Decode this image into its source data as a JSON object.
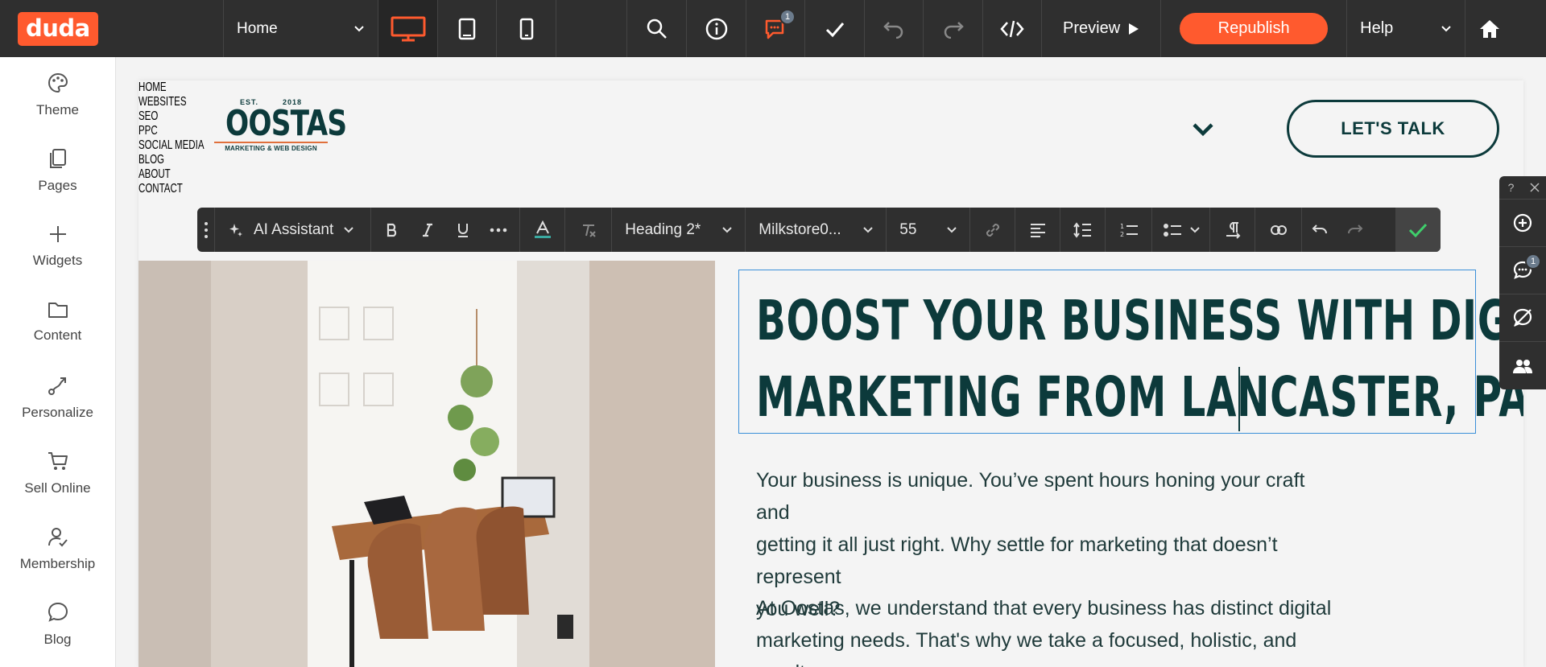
{
  "app": {
    "logo": "duda",
    "page_select": "Home",
    "preview_label": "Preview",
    "republish_label": "Republish",
    "help_label": "Help",
    "comments_badge": "1",
    "brand_color": "#ff5a2e"
  },
  "sidebar": {
    "items": [
      {
        "label": "Theme",
        "icon": "palette-icon"
      },
      {
        "label": "Pages",
        "icon": "pages-icon"
      },
      {
        "label": "Widgets",
        "icon": "plus-icon"
      },
      {
        "label": "Content",
        "icon": "folder-icon"
      },
      {
        "label": "Personalize",
        "icon": "personalize-icon"
      },
      {
        "label": "Sell Online",
        "icon": "cart-icon"
      },
      {
        "label": "Membership",
        "icon": "membership-icon"
      },
      {
        "label": "Blog",
        "icon": "chat-bubble-icon"
      }
    ]
  },
  "site": {
    "logo_est": "EST.",
    "logo_year": "2018",
    "logo_name": "OOSTAS",
    "logo_tagline": "MARKETING & WEB DESIGN",
    "nav": [
      "HOME",
      "WEBSITES",
      "SEO",
      "PPC",
      "SOCIAL MEDIA",
      "BLOG",
      "ABOUT",
      "CONTACT"
    ],
    "cta": "LET'S TALK",
    "heading_line1": "BOOST YOUR BUSINESS WITH DIGITAL",
    "heading_line2": "MARKETING FROM LANCASTER, PA",
    "para1_line1": "Your business is unique. You’ve spent hours honing your craft and",
    "para1_line2": "getting it all just right. Why settle for marketing that doesn’t represent",
    "para1_line3": "you well?",
    "para2_line1": "At Oostas, we understand that every business has distinct digital",
    "para2_line2": "marketing needs. That's why we take a focused, holistic, and results-",
    "text_color": "#0c3a3b"
  },
  "editor_toolbar": {
    "ai_label": "AI Assistant",
    "style_select": "Heading 2*",
    "font_select": "Milkstore0...",
    "size_select": "55"
  },
  "right_panel": {
    "help": "?",
    "badge": "1"
  }
}
